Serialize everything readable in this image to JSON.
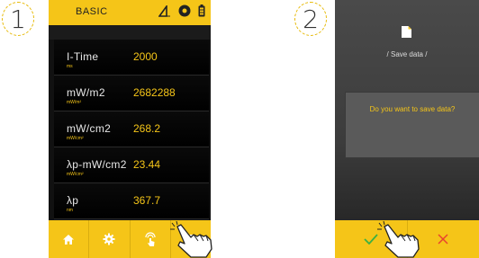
{
  "steps": {
    "one": "1",
    "two": "2"
  },
  "screen1": {
    "title": "BASIC",
    "header_icons": [
      "ruler-icon",
      "settings-badge-icon",
      "battery-icon"
    ],
    "rows": [
      {
        "label": "I-Time",
        "unit": "ms",
        "value": "2000"
      },
      {
        "label": "mW/m2",
        "unit": "mW/m²",
        "value": "2682288"
      },
      {
        "label": "mW/cm2",
        "unit": "mW/cm²",
        "value": "268.2"
      },
      {
        "label": "λp-mW/cm2",
        "unit": "mW/cm²",
        "value": "23.44"
      },
      {
        "label": "λp",
        "unit": "nm",
        "value": "367.7"
      }
    ],
    "footer_icons": [
      "home-icon",
      "gear-icon",
      "touch-icon",
      "save-icon"
    ]
  },
  "screen2": {
    "caption": "/ Save data /",
    "dialog_text": "Do you want to save data?",
    "buttons": [
      "confirm-check",
      "cancel-x"
    ]
  },
  "colors": {
    "accent": "#f5c518",
    "dark": "#111111",
    "confirm": "#3cb043",
    "cancel": "#e8432e"
  }
}
